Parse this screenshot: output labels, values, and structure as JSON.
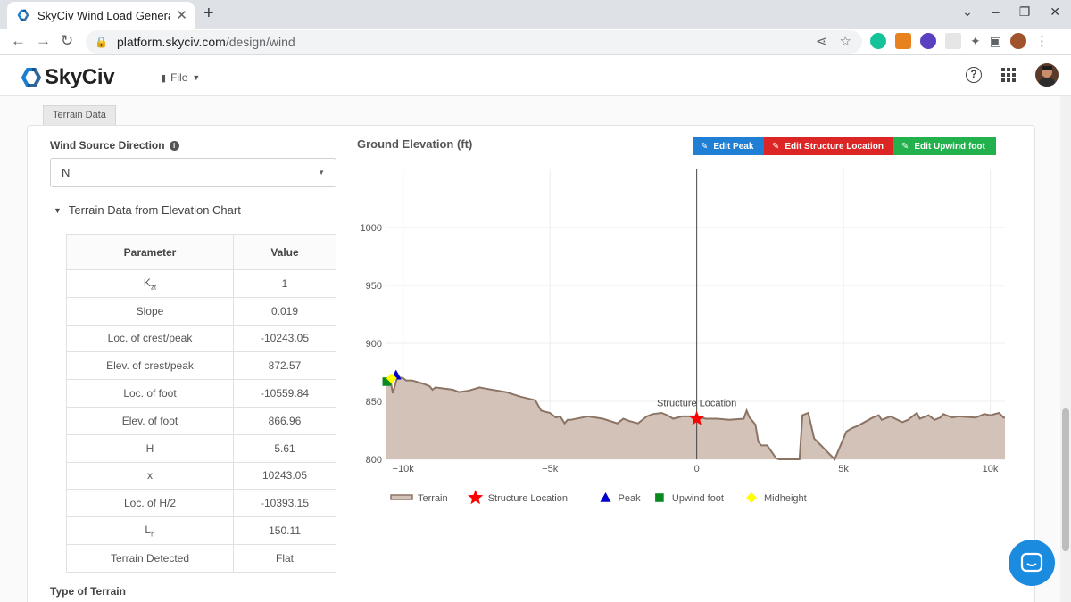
{
  "browser": {
    "tab_title": "SkyCiv Wind Load Generat",
    "url_host": "platform.skyciv.com",
    "url_path": "/design/wind"
  },
  "app": {
    "logo_text": "SkyCiv",
    "file_menu": "File"
  },
  "panel": {
    "tab_label": "Terrain Data",
    "wind_source_label": "Wind Source Direction",
    "wind_source_value": "N",
    "collapse_title": "Terrain Data from Elevation Chart",
    "type_of_terrain_label": "Type of Terrain"
  },
  "table": {
    "headers": [
      "Parameter",
      "Value"
    ],
    "rows": [
      {
        "param": "Kzt",
        "value": "1"
      },
      {
        "param": "Slope",
        "value": "0.019"
      },
      {
        "param": "Loc. of crest/peak",
        "value": "-10243.05"
      },
      {
        "param": "Elev. of crest/peak",
        "value": "872.57"
      },
      {
        "param": "Loc. of foot",
        "value": "-10559.84"
      },
      {
        "param": "Elev. of foot",
        "value": "866.96"
      },
      {
        "param": "H",
        "value": "5.61"
      },
      {
        "param": "x",
        "value": "10243.05"
      },
      {
        "param": "Loc. of H/2",
        "value": "-10393.15"
      },
      {
        "param": "Lh",
        "value": "150.11"
      },
      {
        "param": "Terrain Detected",
        "value": "Flat"
      }
    ]
  },
  "buttons": {
    "edit_peak": "Edit Peak",
    "edit_structure": "Edit Structure Location",
    "edit_upwind": "Edit Upwind foot"
  },
  "chart_data": {
    "type": "area",
    "title": "Ground Elevation (ft)",
    "xlim": [
      -10600,
      10500
    ],
    "ylim": [
      800,
      1050
    ],
    "x_ticks": [
      {
        "v": -10000,
        "label": "−10k"
      },
      {
        "v": -5000,
        "label": "−5k"
      },
      {
        "v": 0,
        "label": "0"
      },
      {
        "v": 5000,
        "label": "5k"
      },
      {
        "v": 10000,
        "label": "10k"
      }
    ],
    "y_ticks": [
      {
        "v": 800,
        "label": "800"
      },
      {
        "v": 850,
        "label": "850"
      },
      {
        "v": 900,
        "label": "900"
      },
      {
        "v": 950,
        "label": "950"
      },
      {
        "v": 1000,
        "label": "1000"
      }
    ],
    "series": [
      {
        "name": "Terrain",
        "color": "#8c7465",
        "fill": "#d2c2b8",
        "x": [
          -10600,
          -10450,
          -10350,
          -10200,
          -10000,
          -9900,
          -9700,
          -9300,
          -9100,
          -9000,
          -8900,
          -8300,
          -8100,
          -7800,
          -7400,
          -7200,
          -6500,
          -6000,
          -5500,
          -5300,
          -5000,
          -4800,
          -4650,
          -4500,
          -4400,
          -4300,
          -3700,
          -3200,
          -2700,
          -2500,
          -2300,
          -2000,
          -1700,
          -1500,
          -1200,
          -1000,
          -800,
          -500,
          -200,
          0,
          300,
          700,
          1100,
          1600,
          1700,
          1800,
          2000,
          2100,
          2200,
          2400,
          2700,
          2800,
          3000,
          3500,
          3600,
          3800,
          4000,
          4700,
          4800,
          5000,
          5100,
          5300,
          5500,
          6000,
          6200,
          6300,
          6600,
          7000,
          7200,
          7500,
          7600,
          7900,
          8100,
          8300,
          8400,
          8700,
          8900,
          9500,
          9800,
          10000,
          10300,
          10450,
          10500
        ],
        "y": [
          866,
          870,
          857,
          871,
          870,
          868,
          868,
          865,
          863,
          860,
          862,
          860,
          858,
          859,
          862,
          861,
          858,
          854,
          851,
          842,
          840,
          836,
          837,
          831,
          834,
          834,
          837,
          835,
          831,
          835,
          833,
          831,
          837,
          839,
          840,
          838,
          835,
          837,
          837,
          837,
          835,
          835,
          834,
          835,
          842,
          836,
          830,
          815,
          812,
          812,
          801,
          800,
          800,
          800,
          838,
          840,
          818,
          800,
          806,
          818,
          824,
          827,
          829,
          836,
          838,
          834,
          837,
          832,
          834,
          840,
          835,
          838,
          834,
          836,
          839,
          836,
          837,
          836,
          839,
          838,
          840,
          836,
          836
        ]
      },
      {
        "name": "Structure Location",
        "color": "#ff0000",
        "marker": "star",
        "x": [
          0
        ],
        "y": [
          835
        ]
      },
      {
        "name": "Peak",
        "color": "#0000cc",
        "marker": "triangle",
        "x": [
          -10243.05
        ],
        "y": [
          872.57
        ]
      },
      {
        "name": "Upwind foot",
        "color": "#0a8a1e",
        "marker": "square",
        "x": [
          -10559.84
        ],
        "y": [
          866.96
        ]
      },
      {
        "name": "Midheight",
        "color": "#ffff00",
        "marker": "diamond",
        "x": [
          -10393.15
        ],
        "y": [
          869.77
        ]
      }
    ],
    "annotations": [
      {
        "text": "Structure Location",
        "x": 0,
        "y": 835
      }
    ]
  }
}
